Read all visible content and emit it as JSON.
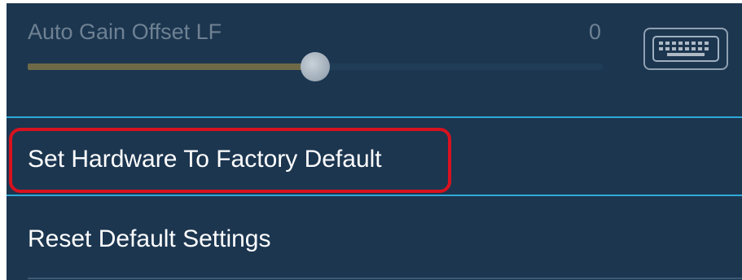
{
  "auto_gain": {
    "label": "Auto Gain Offset LF",
    "value": "0",
    "slider_fraction": 0.5
  },
  "keyboard_button": {
    "icon": "keyboard-icon"
  },
  "menu": {
    "items": [
      {
        "label": "Set Hardware To Factory Default",
        "highlighted": true
      },
      {
        "label": "Reset Default Settings",
        "highlighted": false
      }
    ]
  },
  "colors": {
    "background": "#1c3650",
    "divider": "#2fa9d8",
    "highlight": "#d8121f",
    "slider_fill": "#6e6a48"
  }
}
